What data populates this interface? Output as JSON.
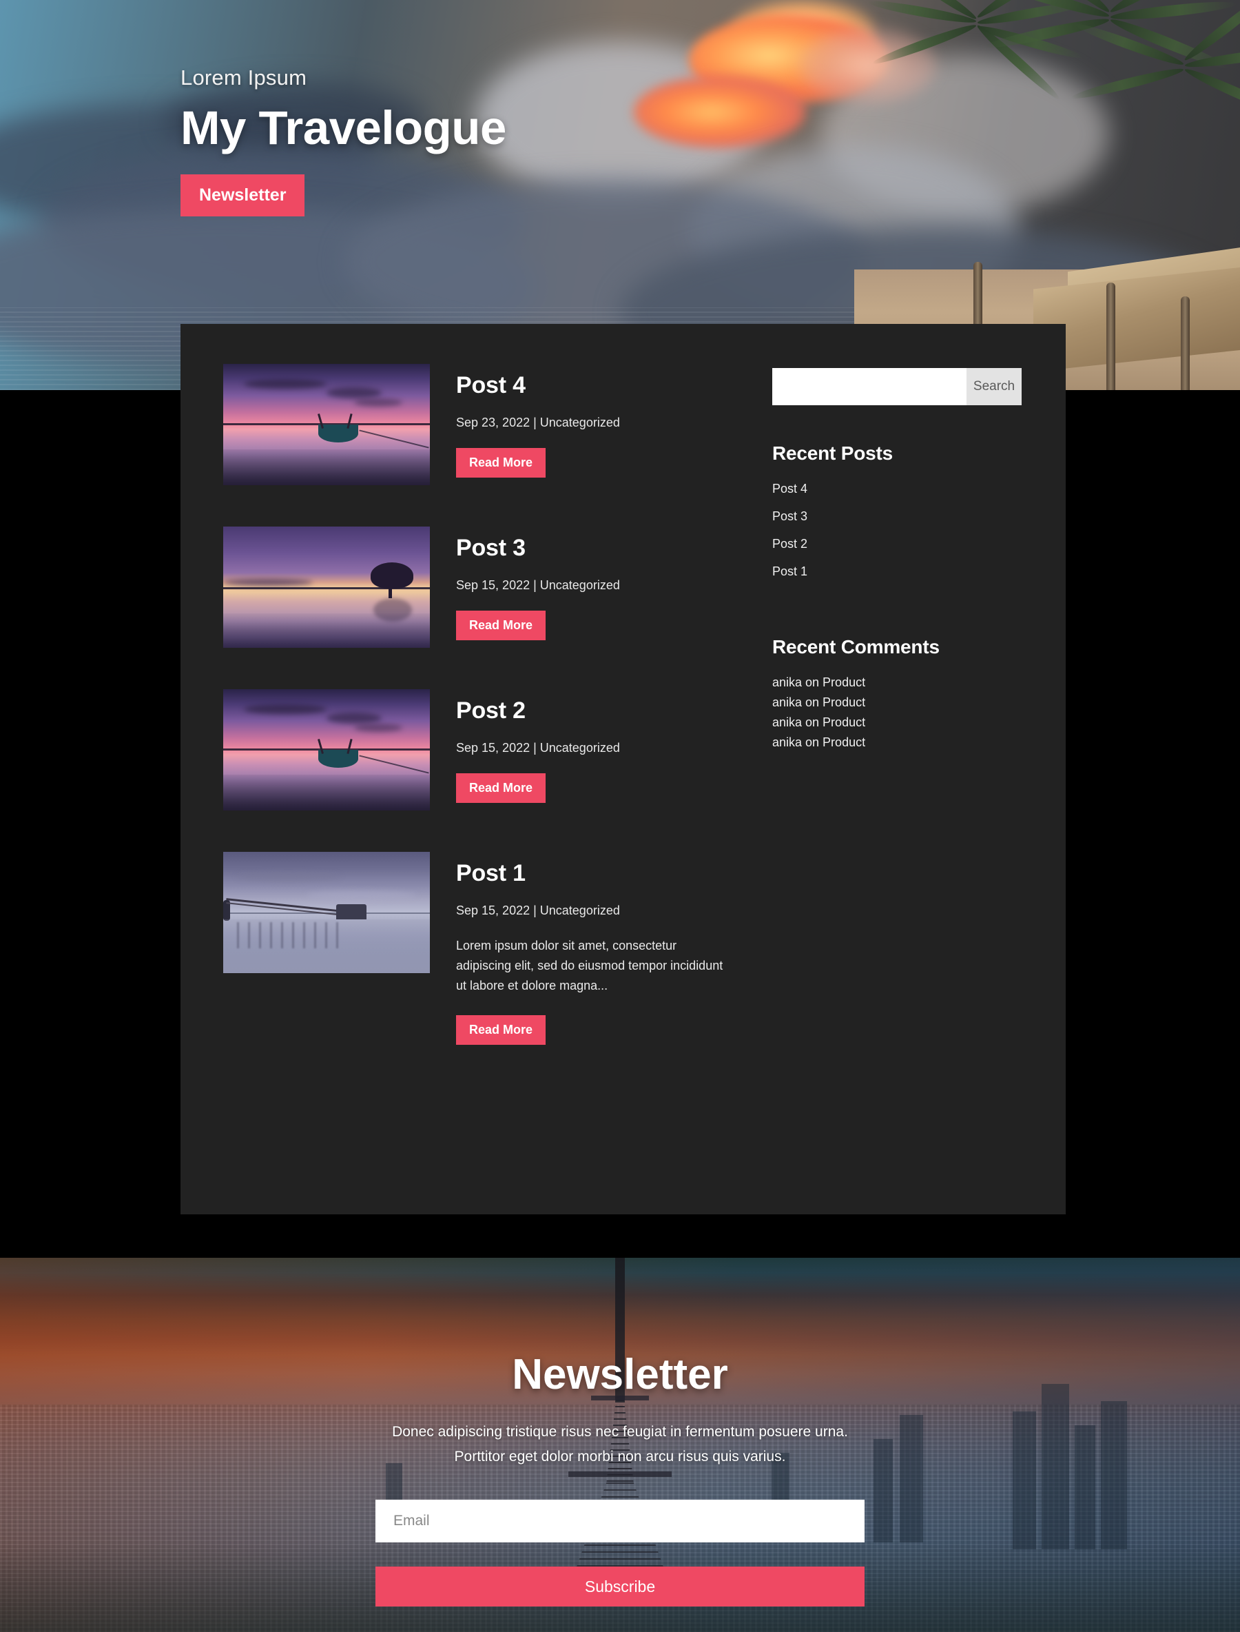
{
  "hero": {
    "eyebrow": "Lorem Ipsum",
    "title": "My Travelogue",
    "cta_label": "Newsletter",
    "background_description": "beach-sunset-palms-photo"
  },
  "theme": {
    "accent": "#ef4963",
    "card_bg": "#222222",
    "page_bg": "#000000",
    "text": "#ffffff"
  },
  "posts": [
    {
      "title": "Post 4",
      "meta": "Sep 23, 2022 | Uncategorized",
      "date": "Sep 23, 2022",
      "category": "Uncategorized",
      "excerpt": "",
      "read_more_label": "Read More",
      "thumbnail": "sunset-boat-purple-photo"
    },
    {
      "title": "Post 3",
      "meta": "Sep 15, 2022 | Uncategorized",
      "date": "Sep 15, 2022",
      "category": "Uncategorized",
      "excerpt": "",
      "read_more_label": "Read More",
      "thumbnail": "lone-tree-purple-sunset-photo"
    },
    {
      "title": "Post 2",
      "meta": "Sep 15, 2022 | Uncategorized",
      "date": "Sep 15, 2022",
      "category": "Uncategorized",
      "excerpt": "",
      "read_more_label": "Read More",
      "thumbnail": "sunset-boat-purple-photo"
    },
    {
      "title": "Post 1",
      "meta": "Sep 15, 2022 | Uncategorized",
      "date": "Sep 15, 2022",
      "category": "Uncategorized",
      "excerpt": "Lorem ipsum dolor sit amet, consectetur adipiscing elit, sed do eiusmod tempor incididunt ut labore et dolore magna...",
      "read_more_label": "Read More",
      "thumbnail": "pier-blue-dusk-photo"
    }
  ],
  "sidebar": {
    "search": {
      "value": "",
      "placeholder": "",
      "button_label": "Search"
    },
    "recent_posts": {
      "heading": "Recent Posts",
      "items": [
        "Post 4",
        "Post 3",
        "Post 2",
        "Post 1"
      ]
    },
    "recent_comments": {
      "heading": "Recent Comments",
      "items": [
        "anika on Product",
        "anika on Product",
        "anika on Product",
        "anika on Product"
      ]
    }
  },
  "newsletter": {
    "title": "Newsletter",
    "subtitle": "Donec adipiscing tristique risus nec feugiat in fermentum posuere urna. Porttitor eget dolor morbi non arcu risus quis varius.",
    "email_value": "",
    "email_placeholder": "Email",
    "submit_label": "Subscribe",
    "background_description": "paris-eiffel-tower-aerial-sunset-photo"
  }
}
